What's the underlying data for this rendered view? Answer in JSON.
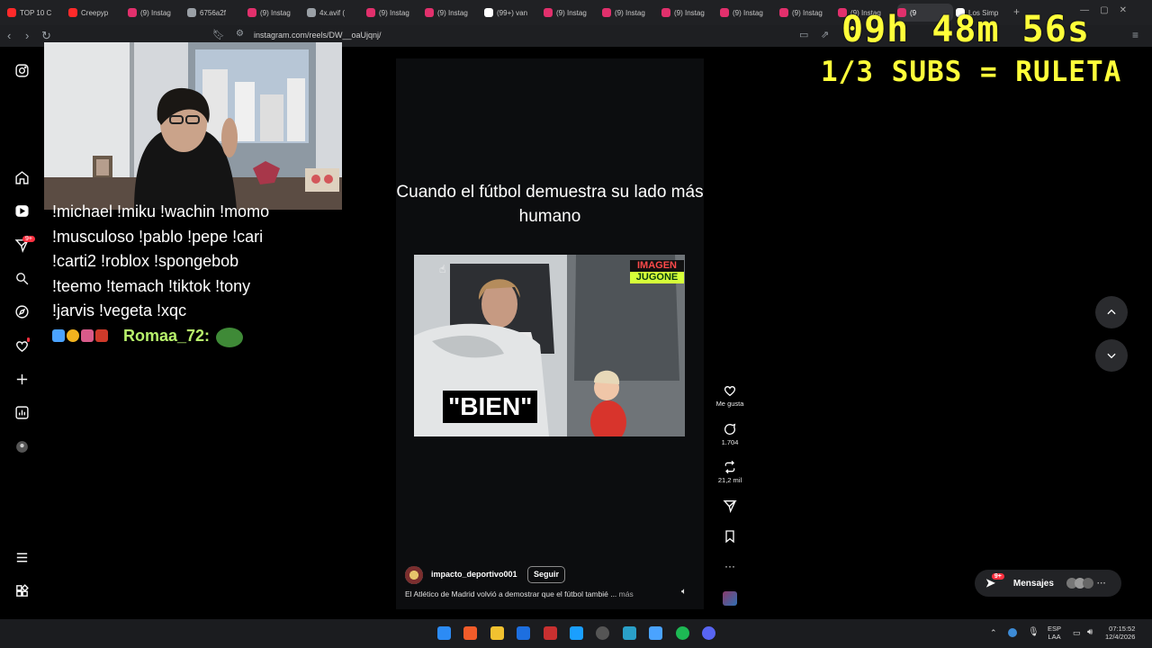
{
  "browser": {
    "tabs": [
      {
        "label": "TOP 10 C",
        "color": "#ff2a2a"
      },
      {
        "label": "Creepyp",
        "color": "#ff2a2a"
      },
      {
        "label": "(9) Instag",
        "color": "#e1306c"
      },
      {
        "label": "6756a2f",
        "color": "#9aa0a6"
      },
      {
        "label": "(9) Instag",
        "color": "#e1306c"
      },
      {
        "label": "4x.avif (",
        "color": "#9aa0a6"
      },
      {
        "label": "(9) Instag",
        "color": "#e1306c"
      },
      {
        "label": "(9) Instag",
        "color": "#e1306c"
      },
      {
        "label": "(99+) van",
        "color": "#ffffff"
      },
      {
        "label": "(9) Instag",
        "color": "#e1306c"
      },
      {
        "label": "(9) Instag",
        "color": "#e1306c"
      },
      {
        "label": "(9) Instag",
        "color": "#e1306c"
      },
      {
        "label": "(9) Instag",
        "color": "#e1306c"
      },
      {
        "label": "(9) Instag",
        "color": "#e1306c"
      },
      {
        "label": "(9) Instag",
        "color": "#e1306c"
      },
      {
        "label": "(9",
        "color": "#e1306c"
      },
      {
        "label": "Los Simp",
        "color": "#ffffff"
      }
    ],
    "new_tab": "+",
    "url": "instagram.com/reels/DW__oaUjqnj/"
  },
  "overlay": {
    "timer": "09h 48m 56s",
    "subs_goal": "1/3 SUBS = RULETA",
    "accent": "#ffff3a"
  },
  "sidebar": {
    "notification_badge": "9+",
    "icons": [
      "instagram-logo-icon",
      "home-icon",
      "reels-icon",
      "messages-icon",
      "search-icon",
      "explore-icon",
      "heart-icon",
      "create-icon",
      "dashboard-icon",
      "profile-icon",
      "menu-icon",
      "more-apps-icon"
    ]
  },
  "chat": {
    "lines": [
      "!michael !miku !wachin !momo",
      "!musculoso !pablo !pepe !cari",
      "!carti2 !roblox !spongebob",
      "!teemo !temach !tiktok !tony",
      "!jarvis !vegeta !xqc"
    ],
    "username": "Romaa_72:",
    "username_color": "#b7f06b"
  },
  "reel": {
    "caption": "Cuando el fútbol demuestra su lado más humano",
    "video_text": "\"BIEN\"",
    "video_tag_top": "IMAGEN",
    "video_tag_bottom": "JUGONE",
    "author": "impacto_deportivo001",
    "follow": "Seguir",
    "description": "El Atlético de Madrid volvió a demostrar que el fútbol tambié ...",
    "more": "más",
    "actions": {
      "like_label": "Me gusta",
      "comments": "1.704",
      "reposts": "21,2 mil"
    }
  },
  "messages": {
    "label": "Mensajes",
    "badge": "9+"
  },
  "taskbar": {
    "lang_top": "ESP",
    "lang_bottom": "LAA",
    "time": "07:15:52",
    "date": "12/4/2026"
  }
}
